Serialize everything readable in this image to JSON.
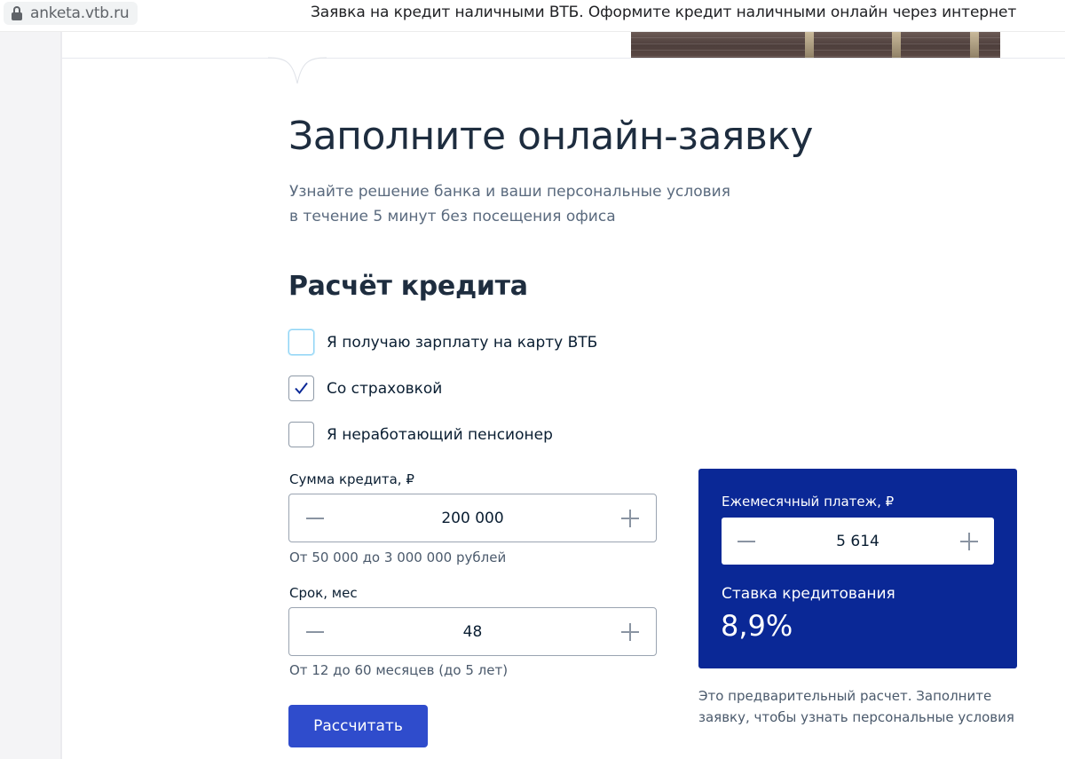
{
  "browser": {
    "url": "anketa.vtb.ru",
    "page_title": "Заявка на кредит наличными ВТБ. Оформите кредит наличными онлайн через интернет"
  },
  "form": {
    "heading": "Заполните онлайн-заявку",
    "subtitle_line1": "Узнайте решение банка и ваши персональные условия",
    "subtitle_line2": "в течение 5 минут без посещения офиса",
    "section_heading": "Расчёт кредита",
    "checkboxes": [
      {
        "label": "Я получаю зарплату на карту ВТБ",
        "checked": false
      },
      {
        "label": "Со страховкой",
        "checked": true
      },
      {
        "label": "Я неработающий пенсионер",
        "checked": false
      }
    ],
    "amount": {
      "label": "Сумма кредита, ₽",
      "value": "200 000",
      "hint": "От 50 000 до 3 000 000 рублей"
    },
    "term": {
      "label": "Срок, мес",
      "value": "48",
      "hint": "От 12 до 60 месяцев (до 5 лет)"
    },
    "calculate_label": "Рассчитать"
  },
  "result": {
    "monthly_label": "Ежемесячный платеж, ₽",
    "monthly_value": "5 614",
    "rate_label": "Ставка кредитования",
    "rate_value": "8,9%",
    "note_line1": "Это предварительный расчет. Заполните",
    "note_line2": "заявку, чтобы узнать персональные условия"
  },
  "colors": {
    "accent_button": "#2f4ccc",
    "result_panel": "#0a2896",
    "check_mark": "#0a2896"
  }
}
